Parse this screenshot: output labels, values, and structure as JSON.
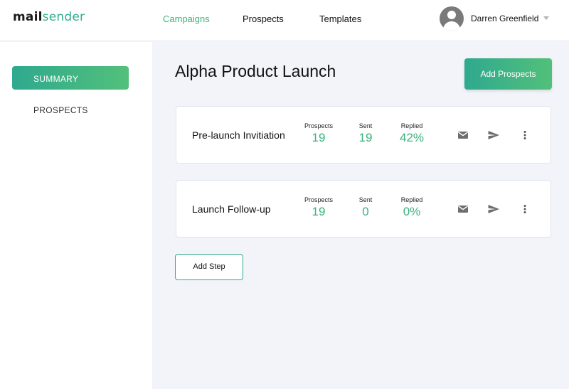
{
  "brand": {
    "part1": "mail",
    "part2": "sender"
  },
  "nav": {
    "campaigns": "Campaigns",
    "prospects": "Prospects",
    "templates": "Templates"
  },
  "user": {
    "name": "Darren Greenfield"
  },
  "sidebar": {
    "items": [
      {
        "label": "SUMMARY",
        "active": true
      },
      {
        "label": "PROSPECTS",
        "active": false
      }
    ]
  },
  "main": {
    "title": "Alpha Product Launch",
    "add_prospects_label": "Add Prospects",
    "add_step_label": "Add Step",
    "steps": [
      {
        "name": "Pre-launch Invitiation",
        "stats": [
          {
            "label": "Prospects",
            "value": "19"
          },
          {
            "label": "Sent",
            "value": "19"
          },
          {
            "label": "Replied",
            "value": "42%"
          }
        ],
        "actions": [
          "mail-icon",
          "send-icon",
          "more-vert-icon"
        ]
      },
      {
        "name": "Launch Follow-up",
        "stats": [
          {
            "label": "Prospects",
            "value": "19"
          },
          {
            "label": "Sent",
            "value": "0"
          },
          {
            "label": "Replied",
            "value": "0%"
          }
        ],
        "actions": [
          "mail-icon",
          "send-icon",
          "more-vert-icon"
        ]
      }
    ]
  },
  "colors": {
    "accent_start": "#2fa98f",
    "accent_end": "#52c07a",
    "stat_value": "#3bb07c",
    "active_nav": "#3fb37f"
  }
}
